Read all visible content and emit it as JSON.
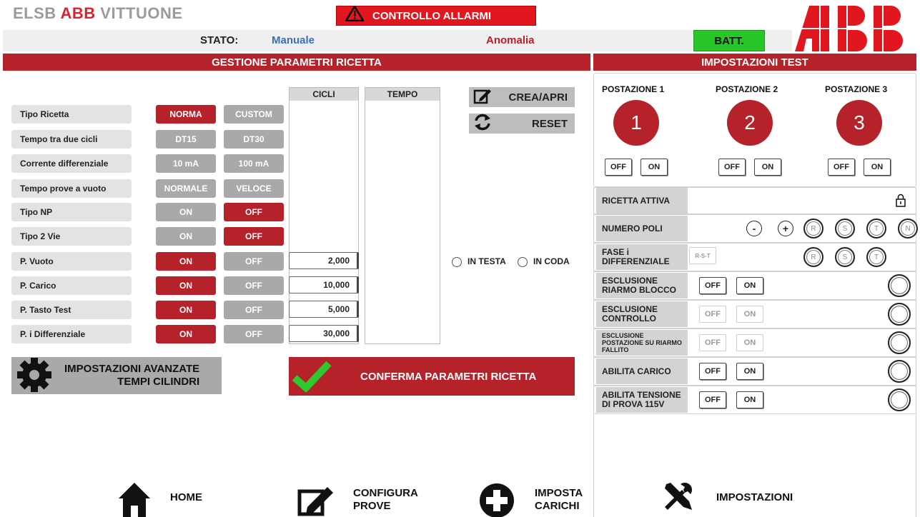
{
  "header": {
    "title_part1": "ELSB",
    "title_part2": "ABB",
    "title_part3": "VITTUONE",
    "alarm_label": "CONTROLLO ALLARMI",
    "stato_label": "STATO:",
    "stato_value": "Manuale",
    "anomalia": "Anomalia",
    "batt_label": "BATT.",
    "logo_text": "ABB"
  },
  "recipe": {
    "section_title": "GESTIONE PARAMETRI RICETTA",
    "col_cicli": "CICLI",
    "col_tempo": "TEMPO",
    "rows": [
      {
        "label": "Tipo Ricetta",
        "opt1": "NORMA",
        "opt2": "CUSTOM",
        "active": 1
      },
      {
        "label": "Tempo tra due cicli",
        "opt1": "DT15",
        "opt2": "DT30",
        "active": 0
      },
      {
        "label": "Corrente differenziale",
        "opt1": "10 mA",
        "opt2": "100 mA",
        "active": 0
      },
      {
        "label": "Tempo prove a vuoto",
        "opt1": "NORMALE",
        "opt2": "VELOCE",
        "active": 0
      },
      {
        "label": "Tipo NP",
        "opt1": "ON",
        "opt2": "OFF",
        "active": 2
      },
      {
        "label": "Tipo 2 Vie",
        "opt1": "ON",
        "opt2": "OFF",
        "active": 2
      },
      {
        "label": "P. Vuoto",
        "opt1": "ON",
        "opt2": "OFF",
        "active": 1,
        "cicli": "2,000"
      },
      {
        "label": "P. Carico",
        "opt1": "ON",
        "opt2": "OFF",
        "active": 1,
        "cicli": "10,000"
      },
      {
        "label": "P. Tasto Test",
        "opt1": "ON",
        "opt2": "OFF",
        "active": 1,
        "cicli": "5,000"
      },
      {
        "label": "P. i Differenziale",
        "opt1": "ON",
        "opt2": "OFF",
        "active": 1,
        "cicli": "30,000"
      }
    ],
    "crea_label": "CREA/APRI",
    "reset_label": "RESET",
    "radio_testa": "IN TESTA",
    "radio_coda": "IN CODA",
    "adv_line1": "IMPOSTAZIONI AVANZATE",
    "adv_line2": "TEMPI CILINDRI",
    "confirm_label": "CONFERMA PARAMETRI RICETTA"
  },
  "test": {
    "section_title": "IMPOSTAZIONI TEST",
    "stations": [
      {
        "title": "POSTAZIONE 1",
        "number": "1",
        "off": "OFF",
        "on": "ON"
      },
      {
        "title": "POSTAZIONE 2",
        "number": "2",
        "off": "OFF",
        "on": "ON"
      },
      {
        "title": "POSTAZIONE 3",
        "number": "3",
        "off": "OFF",
        "on": "ON"
      }
    ],
    "ricetta_attiva": "RICETTA ATTIVA",
    "numero_poli": "NUMERO POLI",
    "minus": "-",
    "plus": "+",
    "poles": [
      "R",
      "S",
      "T",
      "N"
    ],
    "fase_line1": "FASE i",
    "fase_line2": "DIFFERENZIALE",
    "rst_label": "R-S-T",
    "phases": [
      "R",
      "S",
      "T"
    ],
    "options": [
      {
        "line1": "ESCLUSIONE",
        "line2": "RIARMO BLOCCO",
        "off": "OFF",
        "on": "ON",
        "enabled": true
      },
      {
        "line1": "ESCLUSIONE",
        "line2": "CONTROLLO",
        "off": "OFF",
        "on": "ON",
        "enabled": false
      },
      {
        "line1": "ESCLUSIONE",
        "line2": "POSTAZIONE SU RIARMO FALLITO",
        "off": "OFF",
        "on": "ON",
        "enabled": false
      },
      {
        "line1": "ABILITA CARICO",
        "line2": "",
        "off": "OFF",
        "on": "ON",
        "enabled": true
      },
      {
        "line1": "ABILITA TENSIONE",
        "line2": "DI PROVA 115V",
        "off": "OFF",
        "on": "ON",
        "enabled": true
      }
    ]
  },
  "nav": {
    "home": "HOME",
    "configura1": "CONFIGURA",
    "configura2": "PROVE",
    "imposta1": "IMPOSTA",
    "imposta2": "CARICHI",
    "impostazioni": "IMPOSTAZIONI"
  },
  "colors": {
    "accent_red": "#b5222a",
    "alarm_red": "#e2161f",
    "batt_green": "#29c629",
    "inactive_grey": "#a9a9a9",
    "stato_blue": "#3d6fb4"
  }
}
